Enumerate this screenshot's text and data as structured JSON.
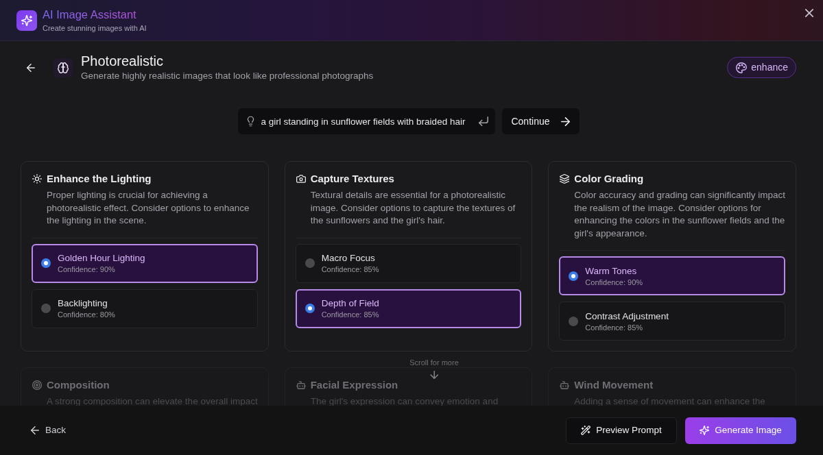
{
  "header": {
    "title": "AI Image Assistant",
    "subtitle": "Create stunning images with AI"
  },
  "style_heading": {
    "title": "Photorealistic",
    "description": "Generate highly realistic images that look like professional photographs",
    "badge": "enhance"
  },
  "prompt": {
    "value": "a girl standing in sunflower fields with braided hair",
    "button": "Continue"
  },
  "sections": [
    {
      "title": "Enhance the Lighting",
      "description": "Proper lighting is crucial for achieving a photorealistic effect. Consider options to enhance the lighting in the scene.",
      "options": [
        {
          "label": "Golden Hour Lighting",
          "confidence": "Confidence: 90%",
          "selected": true
        },
        {
          "label": "Backlighting",
          "confidence": "Confidence: 80%",
          "selected": false
        }
      ]
    },
    {
      "title": "Capture Textures",
      "description": "Textural details are essential for a photorealistic image. Consider options to capture the textures of the sunflowers and the girl's hair.",
      "options": [
        {
          "label": "Macro Focus",
          "confidence": "Confidence: 85%",
          "selected": false
        },
        {
          "label": "Depth of Field",
          "confidence": "Confidence: 85%",
          "selected": true
        }
      ]
    },
    {
      "title": "Color Grading",
      "description": "Color accuracy and grading can significantly impact the realism of the image. Consider options for enhancing the colors in the sunflower fields and the girl's appearance.",
      "options": [
        {
          "label": "Warm Tones",
          "confidence": "Confidence: 90%",
          "selected": true
        },
        {
          "label": "Contrast Adjustment",
          "confidence": "Confidence: 85%",
          "selected": false
        }
      ]
    }
  ],
  "sections_below": [
    {
      "title": "Composition",
      "description": "A strong composition can elevate the overall impact"
    },
    {
      "title": "Facial Expression",
      "description": "The girl's expression can convey emotion and"
    },
    {
      "title": "Wind Movement",
      "description": "Adding a sense of movement can enhance the"
    }
  ],
  "scroll_hint": "Scroll for more",
  "footer": {
    "back": "Back",
    "preview_button": "Preview Prompt",
    "generate_button": "Generate Image"
  }
}
